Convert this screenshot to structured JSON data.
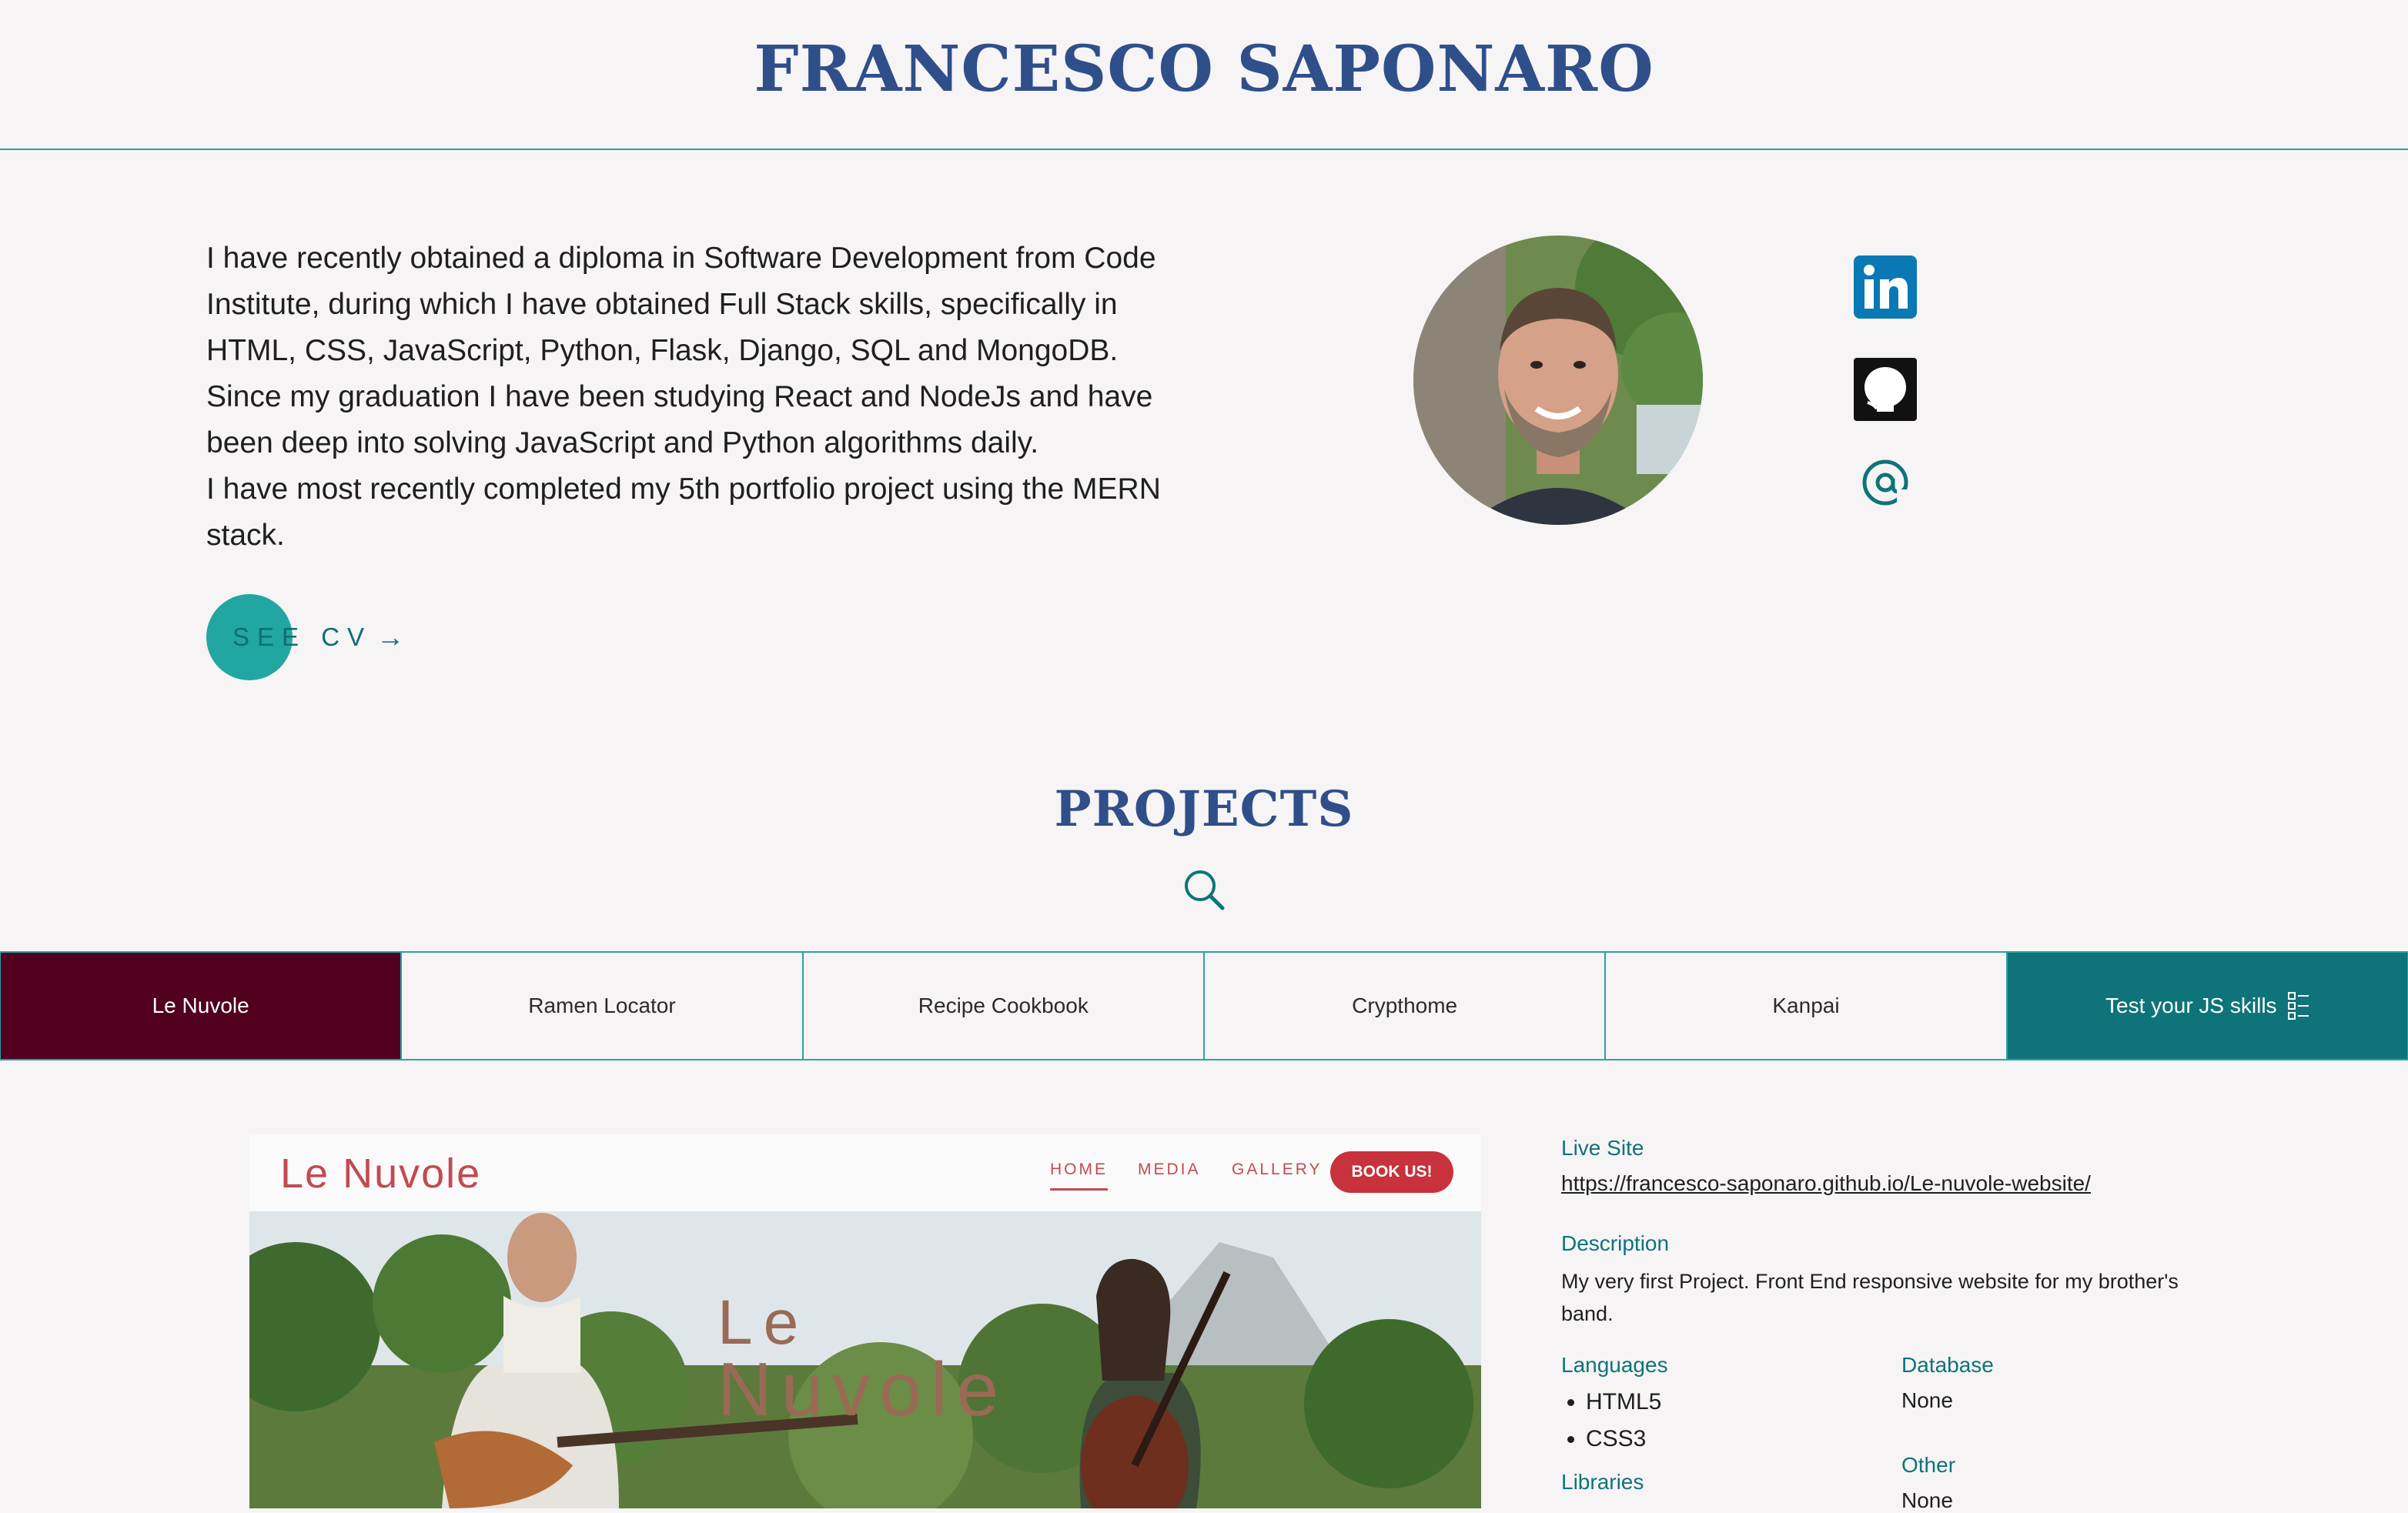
{
  "header": {
    "title": "FRANCESCO SAPONARO"
  },
  "bio": {
    "paragraph1": "I have recently obtained a diploma in Software Development from Code Institute, during which I have obtained Full Stack skills, specifically in HTML, CSS, JavaScript, Python, Flask, Django, SQL and MongoDB. Since my graduation I have been studying React and NodeJs and have been deep into solving JavaScript and Python algorithms daily.",
    "paragraph2": "I have most recently completed my 5th portfolio project using the MERN stack."
  },
  "cv_button": {
    "label": "SEE CV",
    "arrow": "→"
  },
  "social": {
    "icons": [
      "linkedin-icon",
      "github-icon",
      "at-icon"
    ]
  },
  "projects": {
    "title": "PROJECTS",
    "tabs": [
      "Le Nuvole",
      "Ramen Locator",
      "Recipe Cookbook",
      "Crypthome",
      "Kanpai",
      "Test your JS skills"
    ],
    "active_tab": "Le Nuvole"
  },
  "preview": {
    "logo": "Le Nuvole",
    "nav": [
      "HOME",
      "MEDIA",
      "GALLERY"
    ],
    "cta": "BOOK US!",
    "hero_line1": "Le",
    "hero_line2": "Nuvole"
  },
  "details": {
    "live_site_label": "Live Site",
    "live_site_url": "https://francesco-saponaro.github.io/Le-nuvole-website/",
    "description_label": "Description",
    "description": "My very first Project. Front End responsive website for my brother's band.",
    "languages_label": "Languages",
    "languages": [
      "HTML5",
      "CSS3"
    ],
    "database_label": "Database",
    "database": "None",
    "other_label": "Other",
    "other": "None",
    "libraries_label": "Libraries"
  },
  "colors": {
    "primary": "#2f4f8b",
    "accent": "#0e7479",
    "teal": "#22a6a1",
    "active_tab": "#51001e",
    "background": "#f6f4f5"
  }
}
